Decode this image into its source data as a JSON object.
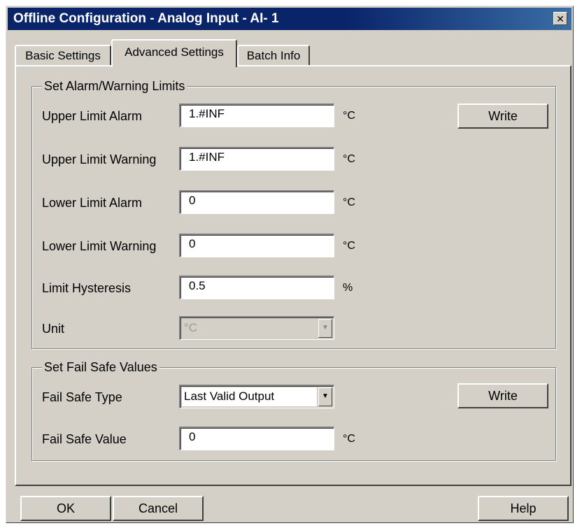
{
  "window": {
    "title": "Offline Configuration - Analog Input - AI- 1",
    "close_glyph": "✕"
  },
  "tabs": [
    "Basic Settings",
    "Advanced Settings",
    "Batch Info"
  ],
  "active_tab": "Advanced Settings",
  "alarm_group": {
    "title": "Set Alarm/Warning Limits",
    "write_label": "Write",
    "rows": [
      {
        "label": "Upper Limit Alarm",
        "value": "1.#INF",
        "unit": "°C"
      },
      {
        "label": "Upper Limit Warning",
        "value": "1.#INF",
        "unit": "°C"
      },
      {
        "label": "Lower Limit Alarm",
        "value": "0",
        "unit": "°C"
      },
      {
        "label": "Lower Limit Warning",
        "value": "0",
        "unit": "°C"
      },
      {
        "label": "Limit Hysteresis",
        "value": "0.5",
        "unit": "%"
      }
    ],
    "unit_label": "Unit",
    "unit_value": "°C",
    "unit_disabled": true
  },
  "failsafe_group": {
    "title": "Set Fail Safe Values",
    "write_label": "Write",
    "type_label": "Fail Safe Type",
    "type_value": "Last Valid Output",
    "value_label": "Fail Safe Value",
    "value": "0",
    "value_unit": "°C"
  },
  "buttons": {
    "ok": "OK",
    "cancel": "Cancel",
    "help": "Help"
  },
  "icons": {
    "close": "close-icon",
    "dropdown": "chevron-down-icon"
  },
  "colors": {
    "titlebar": "#0a246a",
    "face": "#d4d0c8"
  }
}
